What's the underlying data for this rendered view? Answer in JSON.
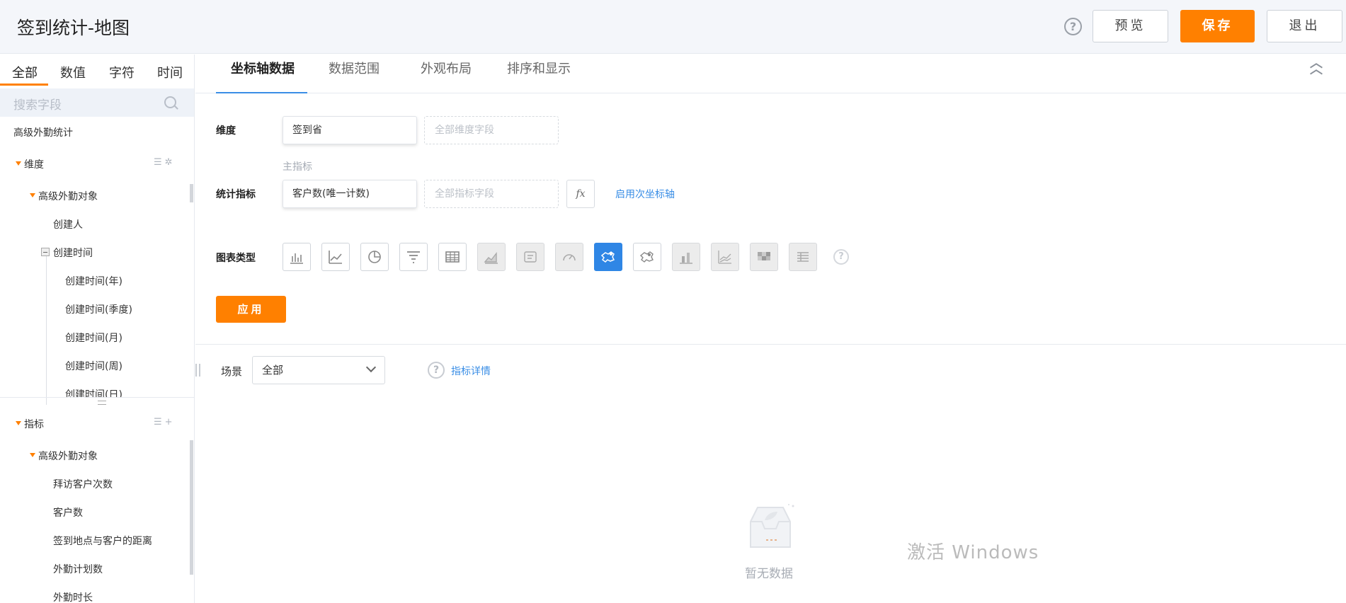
{
  "header": {
    "title": "签到统计-地图",
    "help_glyph": "?",
    "preview_label": "预览",
    "save_label": "保存",
    "quit_label": "退出"
  },
  "sidebar": {
    "tabs": [
      "全部",
      "数值",
      "字符",
      "时间"
    ],
    "active_tab": 0,
    "search_placeholder": "搜索字段",
    "group_title": "高级外勤统计",
    "dimension_label": "维度",
    "dimension_object": "高级外勤对象",
    "dimension_fields": [
      "创建人",
      "创建时间",
      "创建时间(年)",
      "创建时间(季度)",
      "创建时间(月)",
      "创建时间(周)",
      "创建时间(日)"
    ],
    "metric_label": "指标",
    "metric_object": "高级外勤对象",
    "metric_fields": [
      "拜访客户次数",
      "客户数",
      "签到地点与客户的距离",
      "外勤计划数",
      "外勤时长"
    ]
  },
  "main": {
    "tabs": [
      "坐标轴数据",
      "数据范围",
      "外观布局",
      "排序和显示"
    ],
    "active_tab": 0,
    "dimension": {
      "label": "维度",
      "value": "签到省",
      "placeholder": "全部维度字段"
    },
    "metric": {
      "sub_label": "主指标",
      "label": "统计指标",
      "value": "客户数(唯一计数)",
      "placeholder": "全部指标字段",
      "fx_label": "fx",
      "secondary_axis_link": "启用次坐标轴"
    },
    "chart_type": {
      "label": "图表类型",
      "types": [
        {
          "name": "bar",
          "state": "normal"
        },
        {
          "name": "line",
          "state": "normal"
        },
        {
          "name": "pie",
          "state": "normal"
        },
        {
          "name": "funnel",
          "state": "normal"
        },
        {
          "name": "table",
          "state": "normal"
        },
        {
          "name": "area",
          "state": "disabled"
        },
        {
          "name": "card",
          "state": "disabled"
        },
        {
          "name": "gauge",
          "state": "disabled"
        },
        {
          "name": "map",
          "state": "selected"
        },
        {
          "name": "map-bubble",
          "state": "normal"
        },
        {
          "name": "stacked-bar",
          "state": "disabled"
        },
        {
          "name": "combo",
          "state": "disabled"
        },
        {
          "name": "heatmap",
          "state": "disabled"
        },
        {
          "name": "pivot-table",
          "state": "disabled"
        }
      ],
      "help_glyph": "?"
    },
    "apply_label": "应用",
    "scene": {
      "label": "场景",
      "selected": "全部",
      "help_glyph": "?",
      "details_link": "指标详情"
    },
    "empty_text": "暂无数据",
    "watermark": "激活 Windows"
  },
  "colors": {
    "accent": "#ff8000",
    "link": "#3a8ee6",
    "selected": "#2f86e5"
  }
}
